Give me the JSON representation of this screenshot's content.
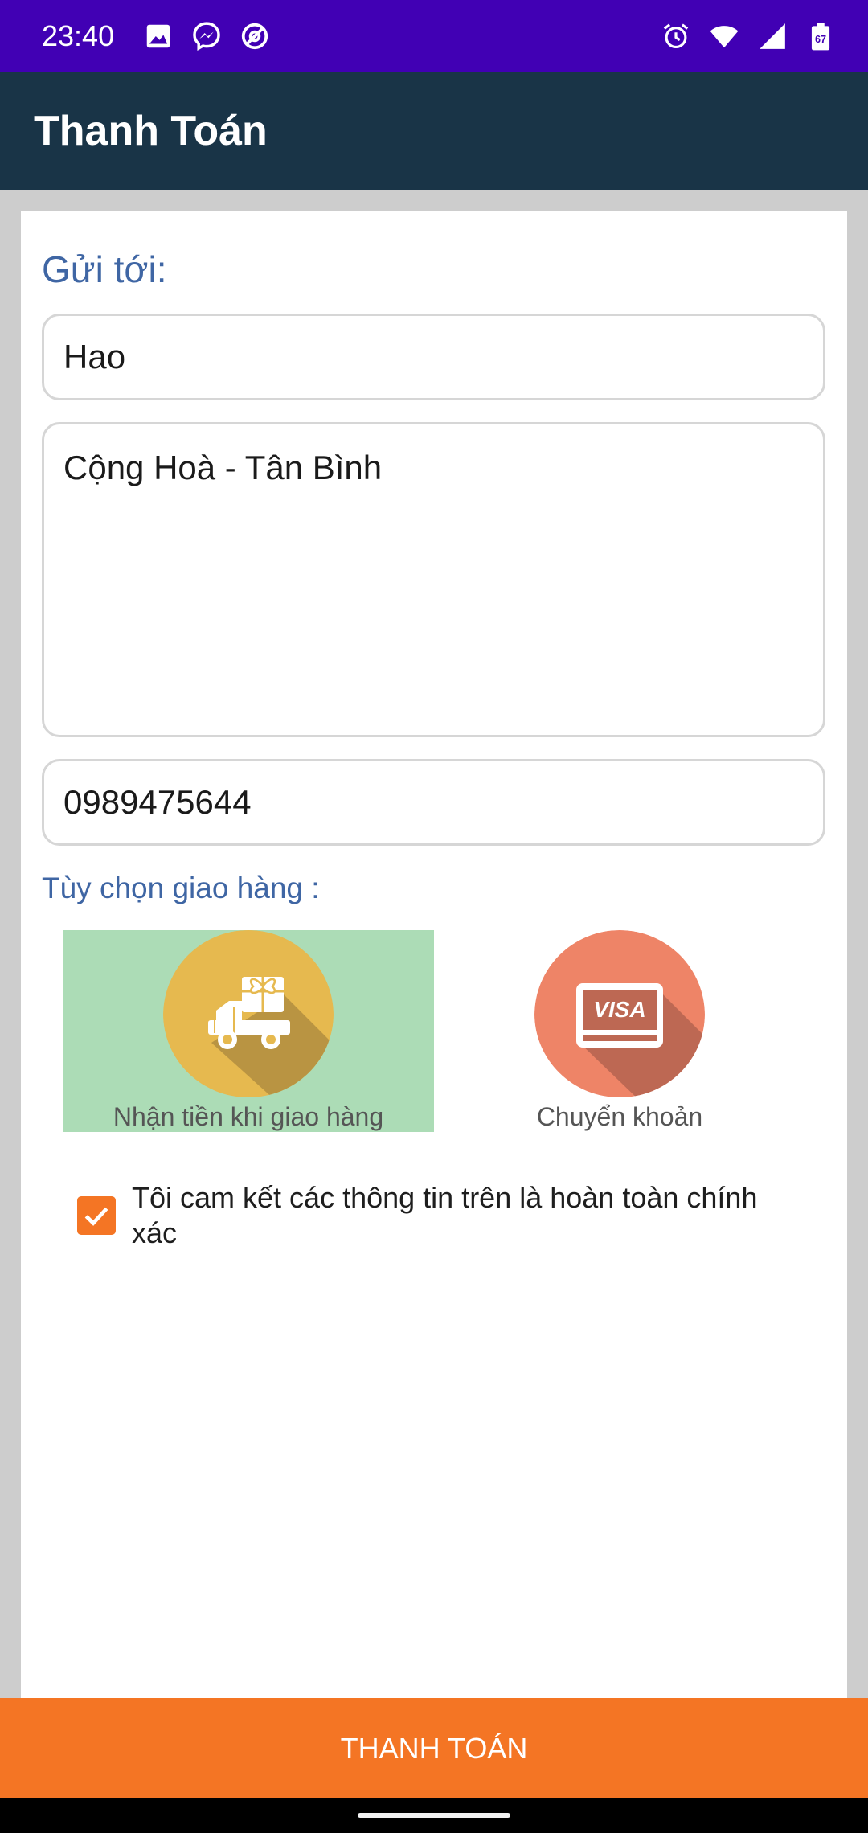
{
  "status_bar": {
    "time": "23:40",
    "battery_level": "67",
    "left_icons": [
      "image-icon",
      "messenger-icon",
      "at-sign-icon"
    ],
    "right_icons": [
      "alarm-icon",
      "wifi-icon",
      "signal-icon",
      "battery-icon"
    ]
  },
  "app_bar": {
    "title": "Thanh Toán"
  },
  "form": {
    "send_to_label": "Gửi tới:",
    "name_value": "Hao",
    "address_value": "Cộng Hoà - Tân Bình",
    "phone_value": "0989475644",
    "delivery_options_label": "Tùy chọn giao hàng :"
  },
  "delivery_options": [
    {
      "label": "Nhận tiền khi giao hàng",
      "icon": "delivery-truck-icon",
      "selected": true,
      "color": "#e6b94f",
      "highlight": "#acdcb6"
    },
    {
      "label": "Chuyển khoản",
      "icon": "visa-card-icon",
      "selected": false,
      "color": "#ee8467",
      "card_text": "VISA"
    }
  ],
  "agreement": {
    "checked": true,
    "text": "Tôi cam kết các thông tin trên là hoàn toàn chính xác"
  },
  "pay_button": {
    "label": "THANH TOÁN"
  },
  "colors": {
    "status_bar": "#4100b4",
    "app_bar": "#193447",
    "accent": "#f47524",
    "label_blue": "#3f66a4"
  }
}
